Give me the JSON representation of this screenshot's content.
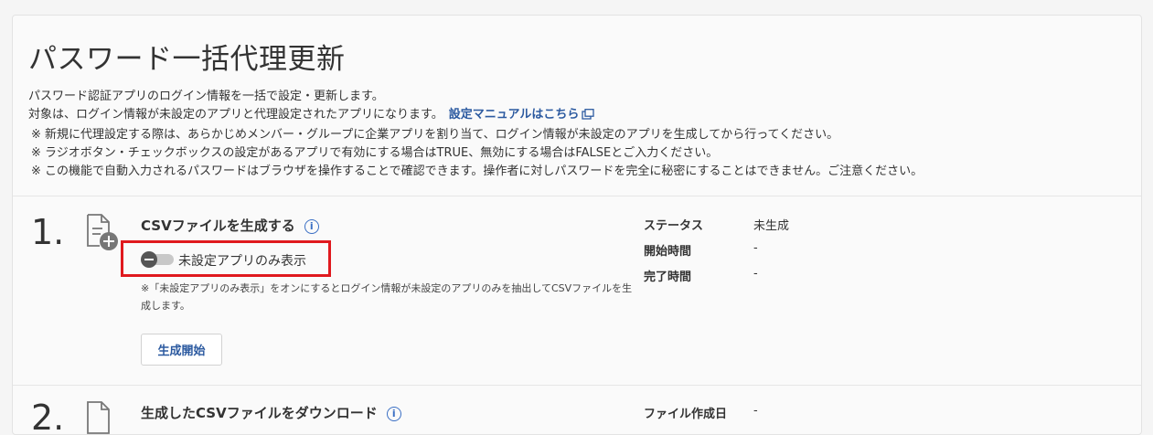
{
  "page": {
    "title": "パスワード一括代理更新",
    "description": [
      "パスワード認証アプリのログイン情報を一括で設定・更新します。",
      "対象は、ログイン情報が未設定のアプリと代理設定されたアプリになります。"
    ],
    "manual_link": "設定マニュアルはこちら",
    "notes": [
      "※ 新規に代理設定する際は、あらかじめメンバー・グループに企業アプリを割り当て、ログイン情報が未設定のアプリを生成してから行ってください。",
      "※ ラジオボタン・チェックボックスの設定があるアプリで有効にする場合はTRUE、無効にする場合はFALSEとご入力ください。",
      "※ この機能で自動入力されるパスワードはブラウザを操作することで確認できます。操作者に対しパスワードを完全に秘密にすることはできません。ご注意ください。"
    ]
  },
  "step1": {
    "number": "1.",
    "title": "CSVファイルを生成する",
    "toggle_label": "未設定アプリのみ表示",
    "toggle_on": false,
    "hint": "※「未設定アプリのみ表示」をオンにするとログイン情報が未設定のアプリのみを抽出してCSVファイルを生成します。",
    "button_label": "生成開始",
    "status": [
      {
        "label": "ステータス",
        "value": "未生成"
      },
      {
        "label": "開始時間",
        "value": "-"
      },
      {
        "label": "完了時間",
        "value": "-"
      }
    ]
  },
  "step2": {
    "number": "2.",
    "title": "生成したCSVファイルをダウンロード",
    "status": [
      {
        "label": "ファイル作成日",
        "value": "-"
      }
    ]
  },
  "colors": {
    "link": "#2c5aa0",
    "highlight_border": "#e0191e",
    "info_icon": "#3a6fc4"
  },
  "icons": [
    "info-icon",
    "external-link-icon",
    "file-add-icon",
    "toggle-off-icon"
  ]
}
